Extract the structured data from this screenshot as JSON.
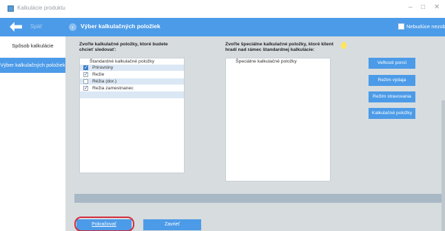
{
  "window": {
    "title": "Kalkulácie produktu",
    "controls": {
      "minimize": "–",
      "maximize": "□",
      "close": "✕"
    }
  },
  "sidebar": {
    "back_label": "Späť",
    "items": [
      {
        "label": "Spôsob kalkulácie",
        "active": false
      },
      {
        "label": "Výber kalkulačných položiek",
        "active": true
      }
    ]
  },
  "header": {
    "title": "Výber kalkulačných položiek",
    "no_offer_label": "Nebudúce nezobr"
  },
  "left_panel": {
    "instruction_line1": "Zvoľte kalkulačné položky, ktoré budete",
    "instruction_line2": "chcieť sledovať:",
    "list_header": "Štandardné kalkulačné položky",
    "items": [
      {
        "label": "Prirovniny",
        "checked": true
      },
      {
        "label": "Režie",
        "checked": true
      },
      {
        "label": "Réžia (dor.)",
        "checked": false
      },
      {
        "label": "Režia zamestnanec",
        "checked": true
      }
    ]
  },
  "right_panel": {
    "instruction_line1": "Zvoľte špeciálne kalkulačné položky, ktoré klient",
    "instruction_line2": "hradí nad rámec štandardnej kalkulácie:",
    "list_header": "Špeciálne kalkulačné položky",
    "items": []
  },
  "side_buttons": [
    {
      "label": "Veľkosti porcií"
    },
    {
      "label": "Režim výdaja"
    },
    {
      "label": "Režim stravovania"
    },
    {
      "label": "Kalkulačné položky"
    }
  ],
  "footer": {
    "continue_label": "Pokračovať",
    "close_label": "Zavrieť"
  },
  "colors": {
    "accent": "#4c9be8",
    "highlight_ring": "#d42a3a",
    "main_bg": "#d7dcdf"
  }
}
